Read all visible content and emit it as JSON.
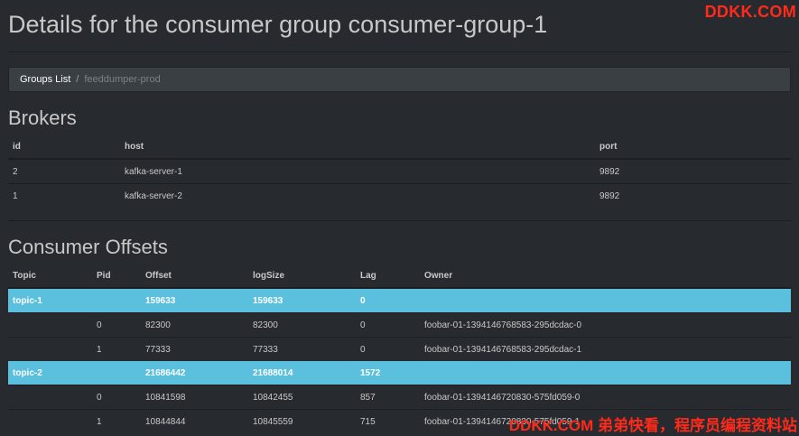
{
  "page": {
    "title": "Details for the consumer group consumer-group-1",
    "watermark_top": "DDKK.COM",
    "watermark_bottom": "DDKK.COM 弟弟快看，程序员编程资料站"
  },
  "breadcrumb": {
    "link": "Groups List",
    "separator": "/",
    "current": "feeddumper-prod"
  },
  "brokers": {
    "title": "Brokers",
    "columns": [
      "id",
      "host",
      "port"
    ],
    "rows": [
      {
        "id": "2",
        "host": "kafka-server-1",
        "port": "9892"
      },
      {
        "id": "1",
        "host": "kafka-server-2",
        "port": "9892"
      }
    ]
  },
  "offsets": {
    "title": "Consumer Offsets",
    "columns": [
      "Topic",
      "Pid",
      "Offset",
      "logSize",
      "Lag",
      "Owner"
    ],
    "rows": [
      {
        "topic": "topic-1",
        "pid": "",
        "offset": "159633",
        "logsize": "159633",
        "lag": "0",
        "owner": ""
      },
      {
        "topic": "",
        "pid": "0",
        "offset": "82300",
        "logsize": "82300",
        "lag": "0",
        "owner": "foobar-01-1394146768583-295dcdac-0"
      },
      {
        "topic": "",
        "pid": "1",
        "offset": "77333",
        "logsize": "77333",
        "lag": "0",
        "owner": "foobar-01-1394146768583-295dcdac-1"
      },
      {
        "topic": "topic-2",
        "pid": "",
        "offset": "21686442",
        "logsize": "21688014",
        "lag": "1572",
        "owner": ""
      },
      {
        "topic": "",
        "pid": "0",
        "offset": "10841598",
        "logsize": "10842455",
        "lag": "857",
        "owner": "foobar-01-1394146720830-575fd059-0"
      },
      {
        "topic": "",
        "pid": "1",
        "offset": "10844844",
        "logsize": "10845559",
        "lag": "715",
        "owner": "foobar-01-1394146720830-575fd059-1"
      }
    ]
  },
  "colors": {
    "background": "#272b30",
    "topic_highlight": "#5bc0de",
    "watermark": "#ff2a1a"
  }
}
